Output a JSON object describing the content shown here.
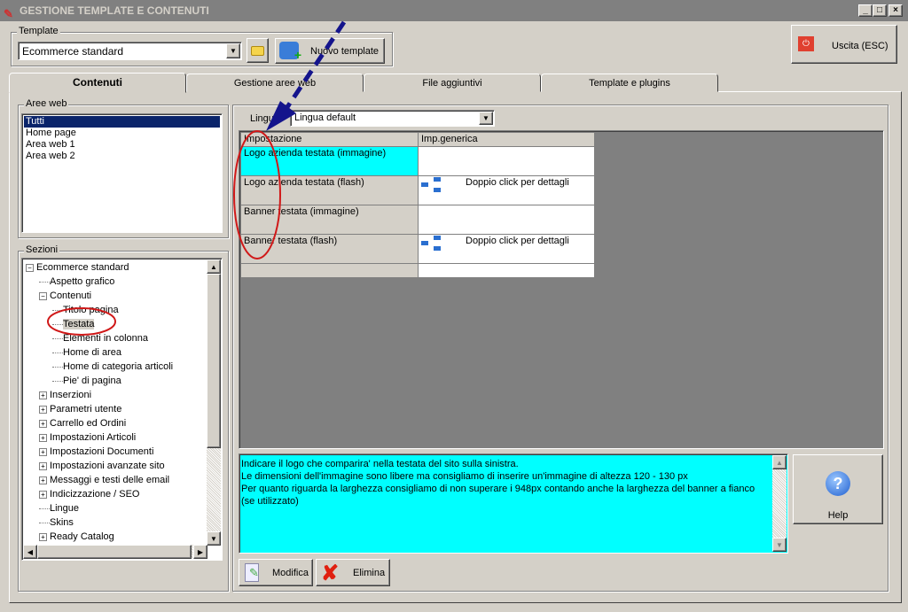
{
  "window": {
    "title": "GESTIONE TEMPLATE E CONTENUTI",
    "min": "_",
    "max": "□",
    "close": "×"
  },
  "template": {
    "group_label": "Template",
    "selected": "Ecommerce standard",
    "new_button": "Nuovo template"
  },
  "exit_button": "Uscita (ESC)",
  "tabs": [
    {
      "label": "Contenuti"
    },
    {
      "label": "Gestione aree web"
    },
    {
      "label": "File aggiuntivi"
    },
    {
      "label": "Template e plugins"
    }
  ],
  "aree_web": {
    "label": "Aree web",
    "items": [
      "Tutti",
      "Home page",
      "Area web 1",
      "Area web 2"
    ]
  },
  "sezioni": {
    "label": "Sezioni",
    "items": [
      {
        "label": "Ecommerce standard",
        "level": 0,
        "exp": "−"
      },
      {
        "label": "Aspetto grafico",
        "level": 1,
        "exp": ""
      },
      {
        "label": "Contenuti",
        "level": 1,
        "exp": "−"
      },
      {
        "label": "Titolo pagina",
        "level": 2,
        "exp": ""
      },
      {
        "label": "Testata",
        "level": 2,
        "exp": "",
        "selected": true
      },
      {
        "label": "Elementi in colonna",
        "level": 2,
        "exp": ""
      },
      {
        "label": "Home di area",
        "level": 2,
        "exp": ""
      },
      {
        "label": "Home di categoria articoli",
        "level": 2,
        "exp": ""
      },
      {
        "label": "Pie' di pagina",
        "level": 2,
        "exp": ""
      },
      {
        "label": "Inserzioni",
        "level": 1,
        "exp": "+"
      },
      {
        "label": "Parametri utente",
        "level": 1,
        "exp": "+"
      },
      {
        "label": "Carrello ed Ordini",
        "level": 1,
        "exp": "+"
      },
      {
        "label": "Impostazioni Articoli",
        "level": 1,
        "exp": "+"
      },
      {
        "label": "Impostazioni Documenti",
        "level": 1,
        "exp": "+"
      },
      {
        "label": "Impostazioni avanzate sito",
        "level": 1,
        "exp": "+"
      },
      {
        "label": "Messaggi e testi delle email",
        "level": 1,
        "exp": "+"
      },
      {
        "label": "Indicizzazione / SEO",
        "level": 1,
        "exp": "+"
      },
      {
        "label": "Lingue",
        "level": 1,
        "exp": ""
      },
      {
        "label": "Skins",
        "level": 1,
        "exp": ""
      },
      {
        "label": "Ready Catalog",
        "level": 1,
        "exp": "+"
      }
    ]
  },
  "lingua": {
    "label": "Lingua",
    "selected": "Lingua default"
  },
  "grid": {
    "headers": [
      "Impostazione",
      "Imp.generica"
    ],
    "rows": [
      {
        "name": "Logo azienda testata (immagine)",
        "value": "",
        "icon": false,
        "selected": true
      },
      {
        "name": "Logo azienda testata (flash)",
        "value": "Doppio click per dettagli",
        "icon": true
      },
      {
        "name": "Banner testata (immagine)",
        "value": "",
        "icon": false
      },
      {
        "name": "Banner testata (flash)",
        "value": "Doppio click per dettagli",
        "icon": true
      },
      {
        "name": "",
        "value": "",
        "icon": false
      }
    ]
  },
  "description": [
    "Indicare il logo che comparira' nella testata del sito sulla sinistra.",
    "Le dimensioni dell'immagine sono libere ma consigliamo di inserire un'immagine di altezza 120 - 130 px",
    "Per quanto riguarda la larghezza consigliamo di non superare i 948px contando anche la larghezza del banner a fianco (se utilizzato)"
  ],
  "buttons": {
    "help": "Help",
    "modifica": "Modifica",
    "elimina": "Elimina"
  },
  "colors": {
    "selection": "#00ffff",
    "list_selection": "#0a246a",
    "annotation_red": "#d01818",
    "arrow": "#14148c"
  }
}
